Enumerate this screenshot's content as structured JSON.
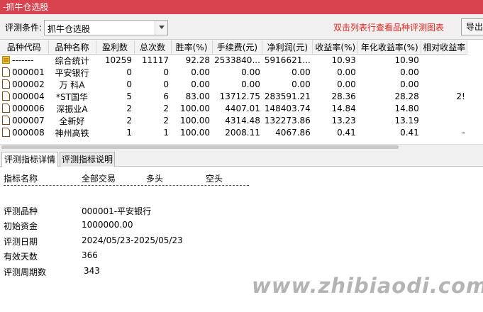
{
  "window": {
    "title": "-抓牛仓选股"
  },
  "toolbar": {
    "condition_label": "评测条件:",
    "condition_value": "抓牛仓选股",
    "hint": "双击列表行查看品种评测图表",
    "export_label": "导出"
  },
  "table": {
    "headers": [
      "品种代码",
      "品种名称",
      "盈利数",
      "总次数",
      "胜率(%)",
      "手续费(元)",
      "净利润(元)",
      "收益率(%)",
      "年化收益率(%)",
      "相对收益率"
    ],
    "rows": [
      [
        "-------",
        "综合统计",
        "10259",
        "11117",
        "92.28",
        "2533840...",
        "5916621...",
        "10.93",
        "10.90",
        ""
      ],
      [
        "000001",
        "平安银行",
        "0",
        "0",
        "0.00",
        "0.00",
        "0.00",
        "0.00",
        "0.00",
        ""
      ],
      [
        "000002",
        "万 科A",
        "0",
        "0",
        "0.00",
        "0.00",
        "0.00",
        "0.00",
        "0.00",
        ""
      ],
      [
        "000004",
        "*ST国华",
        "5",
        "6",
        "83.00",
        "13712.75",
        "283591.21",
        "28.36",
        "28.28",
        "2!"
      ],
      [
        "000006",
        "深振业A",
        "2",
        "2",
        "100.00",
        "4407.01",
        "148403.74",
        "14.84",
        "14.80",
        ""
      ],
      [
        "000007",
        "全新好",
        "2",
        "2",
        "100.00",
        "4314.48",
        "132273.86",
        "13.23",
        "13.19",
        ""
      ],
      [
        "000008",
        "神州高铁",
        "1",
        "1",
        "100.00",
        "2008.11",
        "4067.86",
        "0.41",
        "0.41",
        "-"
      ]
    ]
  },
  "tabs": {
    "detail": "评测指标详情",
    "explain": "评测指标说明"
  },
  "detail": {
    "col_indicator": "指标名称",
    "col_all": "全部交易",
    "col_long": "多头",
    "col_short": "空头",
    "items": [
      {
        "label": "评测品种",
        "value": "000001-平安银行"
      },
      {
        "label": "初始资金",
        "value": "1000000.00"
      },
      {
        "label": "评测日期",
        "value": "2024/05/23-2025/05/23"
      },
      {
        "label": "有效天数",
        "value": "366"
      },
      {
        "label": "评测周期数",
        "value": "343"
      }
    ]
  },
  "watermark": "www.zhibiaodi.com",
  "colors": {
    "titlebar": "#d9434f",
    "hint": "#e0241c",
    "summary_icon": "#f2c230"
  }
}
